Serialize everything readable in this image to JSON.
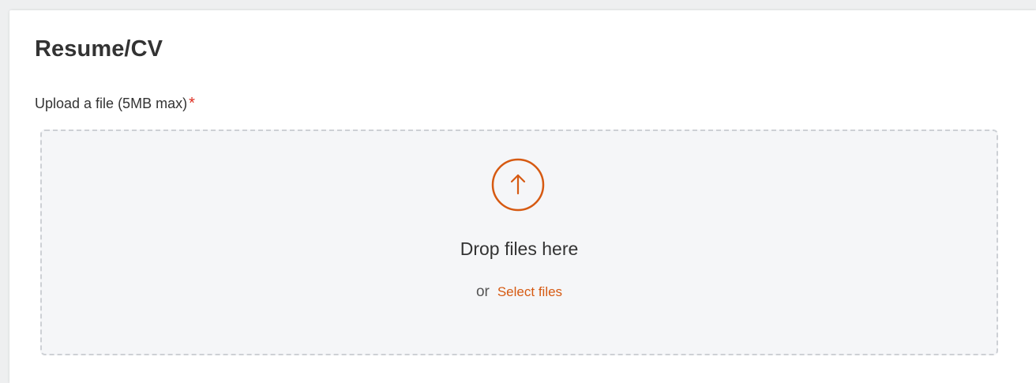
{
  "section": {
    "title": "Resume/CV"
  },
  "upload": {
    "label": "Upload a file (5MB max)",
    "required_marker": "*",
    "icon": "upload-arrow-icon",
    "drop_text": "Drop files here",
    "or_text": "or",
    "select_label": "Select files"
  },
  "colors": {
    "accent": "#d65a12",
    "required": "#de2e21",
    "text": "#333333",
    "dropzone_bg": "#f5f6f8",
    "dropzone_border": "#cdd0d5"
  }
}
